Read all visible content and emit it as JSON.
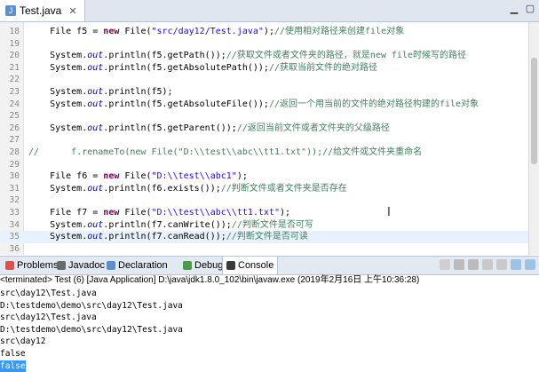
{
  "editor": {
    "tab_label": "Test.java",
    "tab_close": "✕",
    "lines": [
      {
        "n": "18",
        "segs": [
          [
            "p",
            "    File f5 = "
          ],
          [
            "kw",
            "new"
          ],
          [
            "p",
            " File("
          ],
          [
            "st",
            "\"src/day12/Test.java\""
          ],
          [
            "p",
            ");"
          ],
          [
            "cm",
            "//使用相对路径来创建file对象"
          ]
        ]
      },
      {
        "n": "19",
        "segs": []
      },
      {
        "n": "20",
        "segs": [
          [
            "p",
            "    System."
          ],
          [
            "fld",
            "out"
          ],
          [
            "p",
            ".println(f5.getPath());"
          ],
          [
            "cm",
            "//获取文件或者文件夹的路径，就是new file时候写的路径"
          ]
        ]
      },
      {
        "n": "21",
        "segs": [
          [
            "p",
            "    System."
          ],
          [
            "fld",
            "out"
          ],
          [
            "p",
            ".println(f5.getAbsolutePath());"
          ],
          [
            "cm",
            "//获取当前文件的绝对路径"
          ]
        ]
      },
      {
        "n": "22",
        "segs": []
      },
      {
        "n": "23",
        "segs": [
          [
            "p",
            "    System."
          ],
          [
            "fld",
            "out"
          ],
          [
            "p",
            ".println(f5);"
          ]
        ]
      },
      {
        "n": "24",
        "segs": [
          [
            "p",
            "    System."
          ],
          [
            "fld",
            "out"
          ],
          [
            "p",
            ".println(f5.getAbsoluteFile());"
          ],
          [
            "cm",
            "//返回一个用当前的文件的绝对路径构建的file对象"
          ]
        ]
      },
      {
        "n": "25",
        "segs": []
      },
      {
        "n": "26",
        "segs": [
          [
            "p",
            "    System."
          ],
          [
            "fld",
            "out"
          ],
          [
            "p",
            ".println(f5.getParent());"
          ],
          [
            "cm",
            "//返回当前文件或者文件夹的父级路径"
          ]
        ]
      },
      {
        "n": "27",
        "segs": []
      },
      {
        "n": "28",
        "segs": [
          [
            "cm",
            "//      f.renameTo(new File(\"D:\\\\test\\\\abc\\\\tt1.txt\"));//给文件或文件夹重命名"
          ]
        ]
      },
      {
        "n": "29",
        "segs": []
      },
      {
        "n": "30",
        "segs": [
          [
            "p",
            "    File f6 = "
          ],
          [
            "kw",
            "new"
          ],
          [
            "p",
            " File("
          ],
          [
            "st",
            "\"D:\\\\test\\\\abc1\""
          ],
          [
            "p",
            ");"
          ]
        ]
      },
      {
        "n": "31",
        "segs": [
          [
            "p",
            "    System."
          ],
          [
            "fld",
            "out"
          ],
          [
            "p",
            ".println(f6.exists());"
          ],
          [
            "cm",
            "//判断文件或者文件夹是否存在"
          ]
        ]
      },
      {
        "n": "32",
        "segs": []
      },
      {
        "n": "33",
        "segs": [
          [
            "p",
            "    File f7 = "
          ],
          [
            "kw",
            "new"
          ],
          [
            "p",
            " File("
          ],
          [
            "st",
            "\"D:\\\\test\\\\abc\\\\tt1.txt\""
          ],
          [
            "p",
            ");"
          ]
        ]
      },
      {
        "n": "34",
        "segs": [
          [
            "p",
            "    System."
          ],
          [
            "fld",
            "out"
          ],
          [
            "p",
            ".println(f7.canWrite());"
          ],
          [
            "cm",
            "//判断文件是否可写"
          ]
        ]
      },
      {
        "n": "35",
        "segs": [
          [
            "p",
            "    System."
          ],
          [
            "fld",
            "out"
          ],
          [
            "p",
            ".println(f7.canRead());"
          ],
          [
            "cm",
            "//判断文件是否可读"
          ]
        ]
      },
      {
        "n": "36",
        "segs": []
      }
    ],
    "highlighted_line": "35",
    "cursor_icon": "I"
  },
  "bottom_panel": {
    "tabs": [
      {
        "label": "Problems",
        "icon": "problems-icon",
        "color": "#d9534f"
      },
      {
        "label": "Javadoc",
        "icon": "at-icon",
        "color": "#6a6a6a"
      },
      {
        "label": "Declaration",
        "icon": "declaration-icon",
        "color": "#5b8fcf"
      },
      {
        "label": "Debug",
        "icon": "debug-icon",
        "color": "#4a9a4a"
      },
      {
        "label": "Console",
        "icon": "console-icon",
        "color": "#3a3a3a",
        "active": true
      }
    ],
    "status": "<terminated> Test (6) [Java Application] D:\\java\\jdk1.8.0_102\\bin\\javaw.exe (2019年2月16日 上午10:36:28)",
    "console_lines": [
      "src\\day12\\Test.java",
      "D:\\testdemo\\demo\\src\\day12\\Test.java",
      "src\\day12\\Test.java",
      "D:\\testdemo\\demo\\src\\day12\\Test.java",
      "src\\day12",
      "false",
      "false"
    ],
    "selected_console_line": 6
  }
}
